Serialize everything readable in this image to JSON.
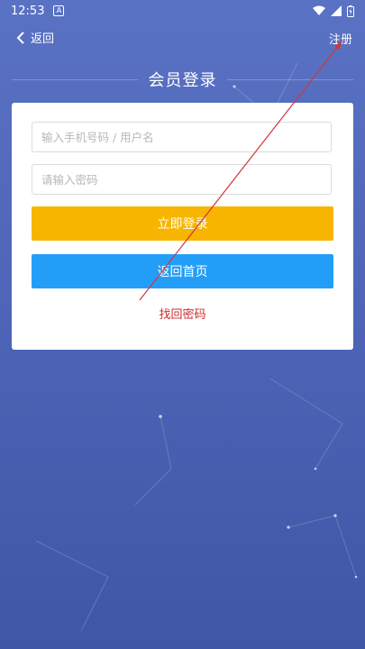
{
  "status_bar": {
    "time": "12:53",
    "app_badge": "A",
    "icons": [
      "wifi-icon",
      "signal-icon",
      "battery-icon"
    ]
  },
  "nav": {
    "back_label": "返回",
    "register_label": "注册"
  },
  "page": {
    "title": "会员登录"
  },
  "form": {
    "username_placeholder": "输入手机号码 / 用户名",
    "password_placeholder": "请输入密码",
    "login_label": "立即登录",
    "home_label": "返回首页",
    "forgot_label": "找回密码"
  },
  "colors": {
    "login_button": "#f8b500",
    "home_button": "#229ef9",
    "forgot_link": "#d02a2a",
    "background": "#5a72c4"
  }
}
